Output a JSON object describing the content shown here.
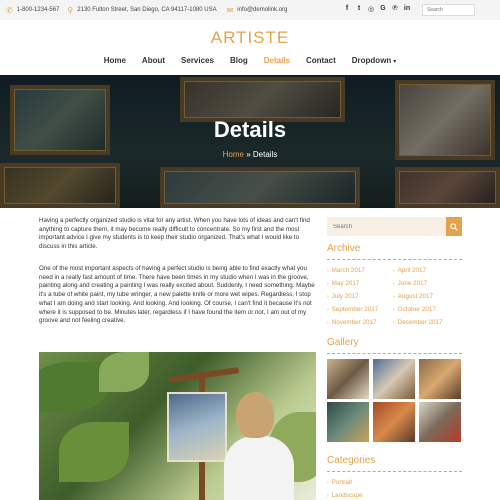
{
  "topbar": {
    "phone": "1-800-1234-567",
    "address": "2130 Fulton Street, San Diego, CA 94117-1080 USA",
    "email": "info@demolink.org",
    "social": [
      "f",
      "t",
      "ig",
      "G",
      "p",
      "in"
    ],
    "search_placeholder": "Search"
  },
  "logo": "ARTISTE",
  "nav": {
    "items": [
      "Home",
      "About",
      "Services",
      "Blog",
      "Details",
      "Contact",
      "Dropdown"
    ],
    "active": "Details"
  },
  "hero": {
    "title": "Details",
    "crumb_home": "Home",
    "crumb_sep": "»",
    "crumb_current": "Details"
  },
  "content": {
    "p1": "Having a perfectly organized studio is vital for any artist. When you have lots of ideas and can't find anything to capture them, it may become really difficult to concentrate. So my first and the most important advice I give my students is to keep their studio organized. That's what I would like to discuss in this article.",
    "p2": "One of the most important aspects of having a perfect studio is being able to find exactly what you need in a really fast amount of time. There have been times in my studio when I was in the groove, painting along and creating a painting I was really excited about. Suddenly, I need something. Maybe it's a tube of white paint, my tube wringer, a new palette knife or more wet wipes. Regardless, I stop what I am doing and start looking. And looking. And looking. Of course, I can't find it because it's not where it is supposed to be. Minutes later, regardless if I have found the item or not, I am out of my groove and not feeling creative."
  },
  "sidebar": {
    "search_placeholder": "Search",
    "archive_title": "Archive",
    "archive": [
      "March 2017",
      "April 2017",
      "May 2017",
      "June 2017",
      "July 2017",
      "August 2017",
      "September 2017",
      "October 2017",
      "November 2017",
      "December 2017"
    ],
    "gallery_title": "Gallery",
    "categories_title": "Categories",
    "categories": [
      "Portrait",
      "Landscape"
    ]
  },
  "colors": {
    "accent": "#e3a24c",
    "topbar_bg": "#f4f4f4",
    "search_bg": "#f7efe3"
  }
}
